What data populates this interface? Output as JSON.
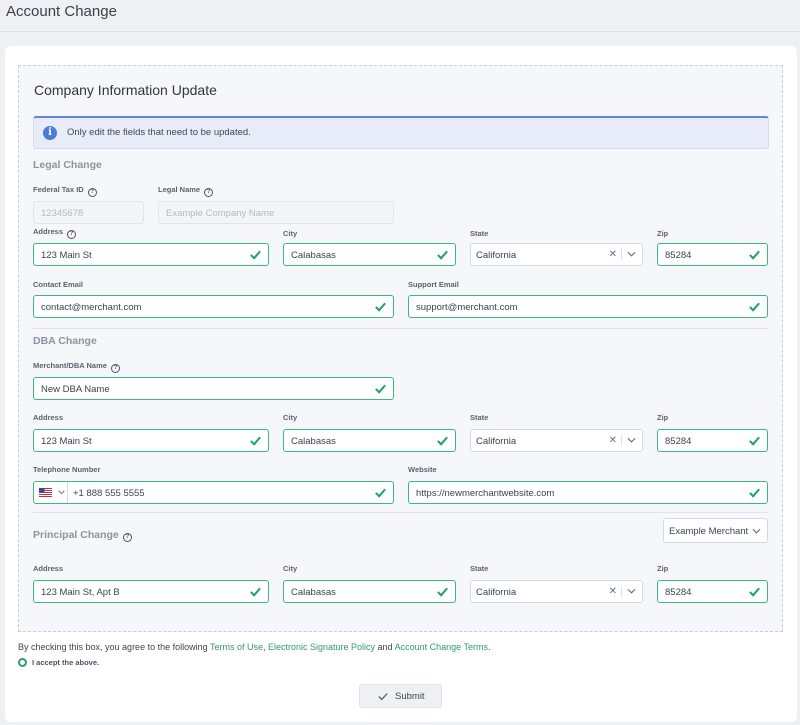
{
  "page": {
    "title": "Account Change"
  },
  "panel": {
    "title": "Company Information Update",
    "info": "Only edit the fields that need to be updated."
  },
  "legal": {
    "title": "Legal Change",
    "federal_tax_id": {
      "label": "Federal Tax ID",
      "placeholder": "12345678"
    },
    "legal_name": {
      "label": "Legal Name",
      "placeholder": "Example Company Name"
    },
    "address": {
      "label": "Address",
      "value": "123 Main St"
    },
    "city": {
      "label": "City",
      "value": "Calabasas"
    },
    "state": {
      "label": "State",
      "value": "California"
    },
    "zip": {
      "label": "Zip",
      "value": "85284"
    },
    "contact_email": {
      "label": "Contact Email",
      "value": "contact@merchant.com"
    },
    "support_email": {
      "label": "Support Email",
      "value": "support@merchant.com"
    }
  },
  "dba": {
    "title": "DBA Change",
    "merchant_name": {
      "label": "Merchant/DBA Name",
      "value": "New DBA Name"
    },
    "address": {
      "label": "Address",
      "value": "123 Main St"
    },
    "city": {
      "label": "City",
      "value": "Calabasas"
    },
    "state": {
      "label": "State",
      "value": "California"
    },
    "zip": {
      "label": "Zip",
      "value": "85284"
    },
    "telephone": {
      "label": "Telephone Number",
      "value": "+1 888 555 5555",
      "country_flag": "us-flag-icon"
    },
    "website": {
      "label": "Website",
      "value": "https://newmerchantwebsite.com"
    }
  },
  "principal": {
    "title": "Principal Change",
    "merchant_select": "Example Merchant",
    "address": {
      "label": "Address",
      "value": "123 Main St, Apt B"
    },
    "city": {
      "label": "City",
      "value": "Calabasas"
    },
    "state": {
      "label": "State",
      "value": "California"
    },
    "zip": {
      "label": "Zip",
      "value": "85284"
    }
  },
  "agreement": {
    "prefix": "By checking this box, you agree to the following ",
    "terms_of_use": "Terms of Use",
    "comma": ", ",
    "esign_policy": "Electronic Signature Policy",
    "and": " and ",
    "account_change_terms": "Account Change Terms",
    "suffix": ".",
    "accept_label": "I accept the above."
  },
  "submit_label": "Submit",
  "colors": {
    "valid_border": "#3fb585",
    "check": "#22a06b",
    "link": "#2f9c6b",
    "info_accent": "#4a7cdb"
  }
}
